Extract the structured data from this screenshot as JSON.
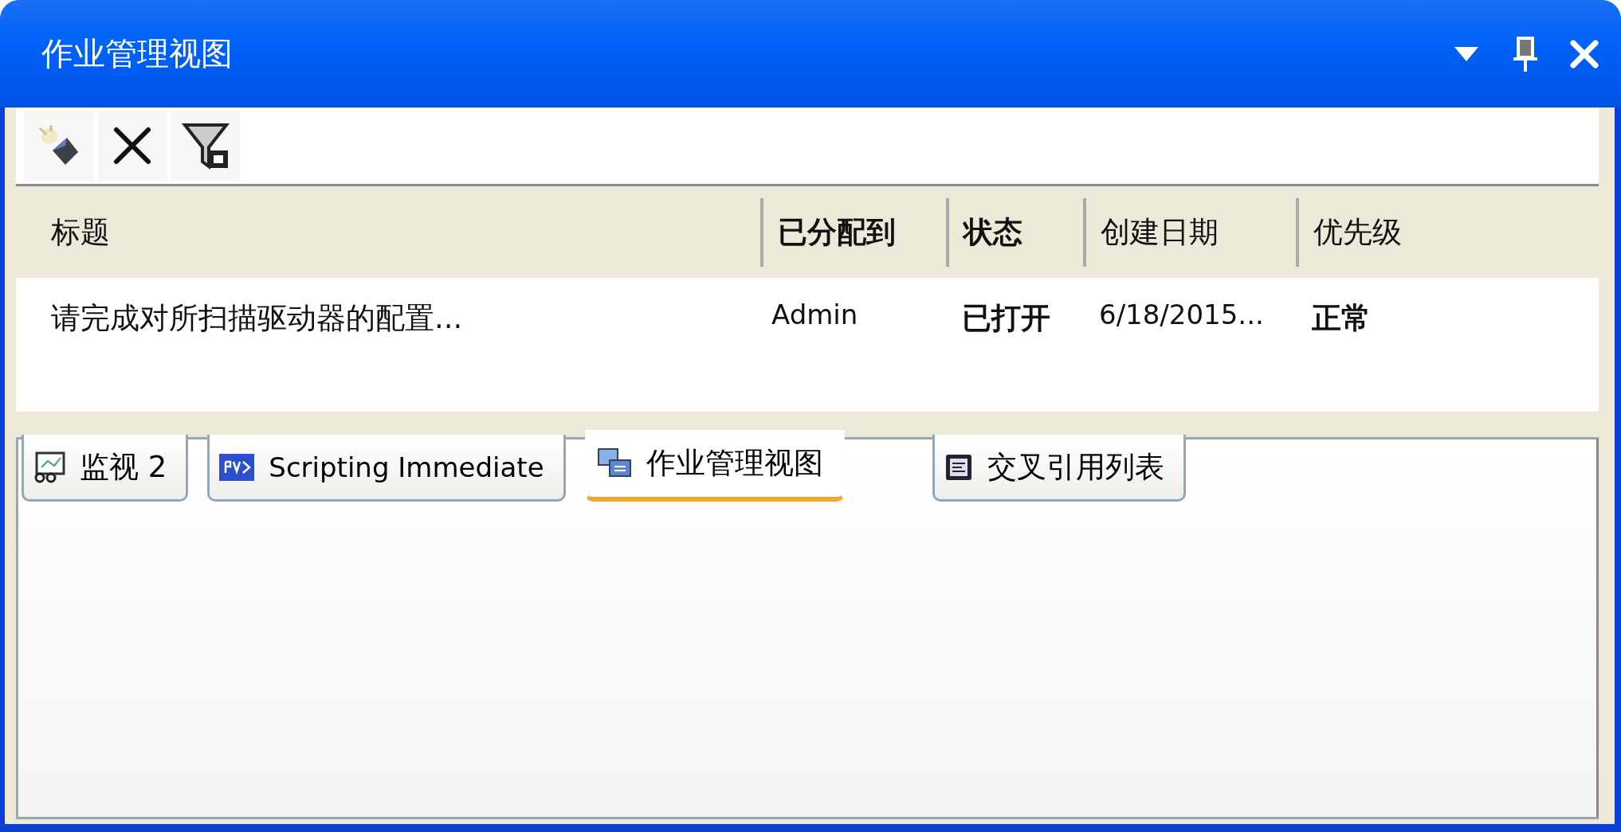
{
  "window": {
    "title": "作业管理视图"
  },
  "toolbar": {
    "buttons": [
      {
        "kind": "new"
      },
      {
        "kind": "delete"
      },
      {
        "kind": "filter"
      }
    ]
  },
  "table": {
    "columns": [
      {
        "label": "标题",
        "bold": false
      },
      {
        "label": "已分配到",
        "bold": true
      },
      {
        "label": "状态",
        "bold": true
      },
      {
        "label": "创建日期",
        "bold": false
      },
      {
        "label": "优先级",
        "bold": false
      }
    ],
    "rows": [
      {
        "cells": [
          {
            "text": "请完成对所扫描驱动器的配置...",
            "bold": false
          },
          {
            "text": "Admin",
            "bold": false
          },
          {
            "text": "已打开",
            "bold": true
          },
          {
            "text": "6/18/2015...",
            "bold": false
          },
          {
            "text": "正常",
            "bold": true
          }
        ]
      }
    ]
  },
  "tabs": [
    {
      "label": "监视 2",
      "kind": "monitor",
      "selected": false
    },
    {
      "label": "Scripting Immediate",
      "kind": "script",
      "selected": false
    },
    {
      "label": "作业管理视图",
      "kind": "jobs",
      "selected": true
    },
    {
      "label": "交叉引用列表",
      "kind": "xref",
      "selected": false
    }
  ]
}
